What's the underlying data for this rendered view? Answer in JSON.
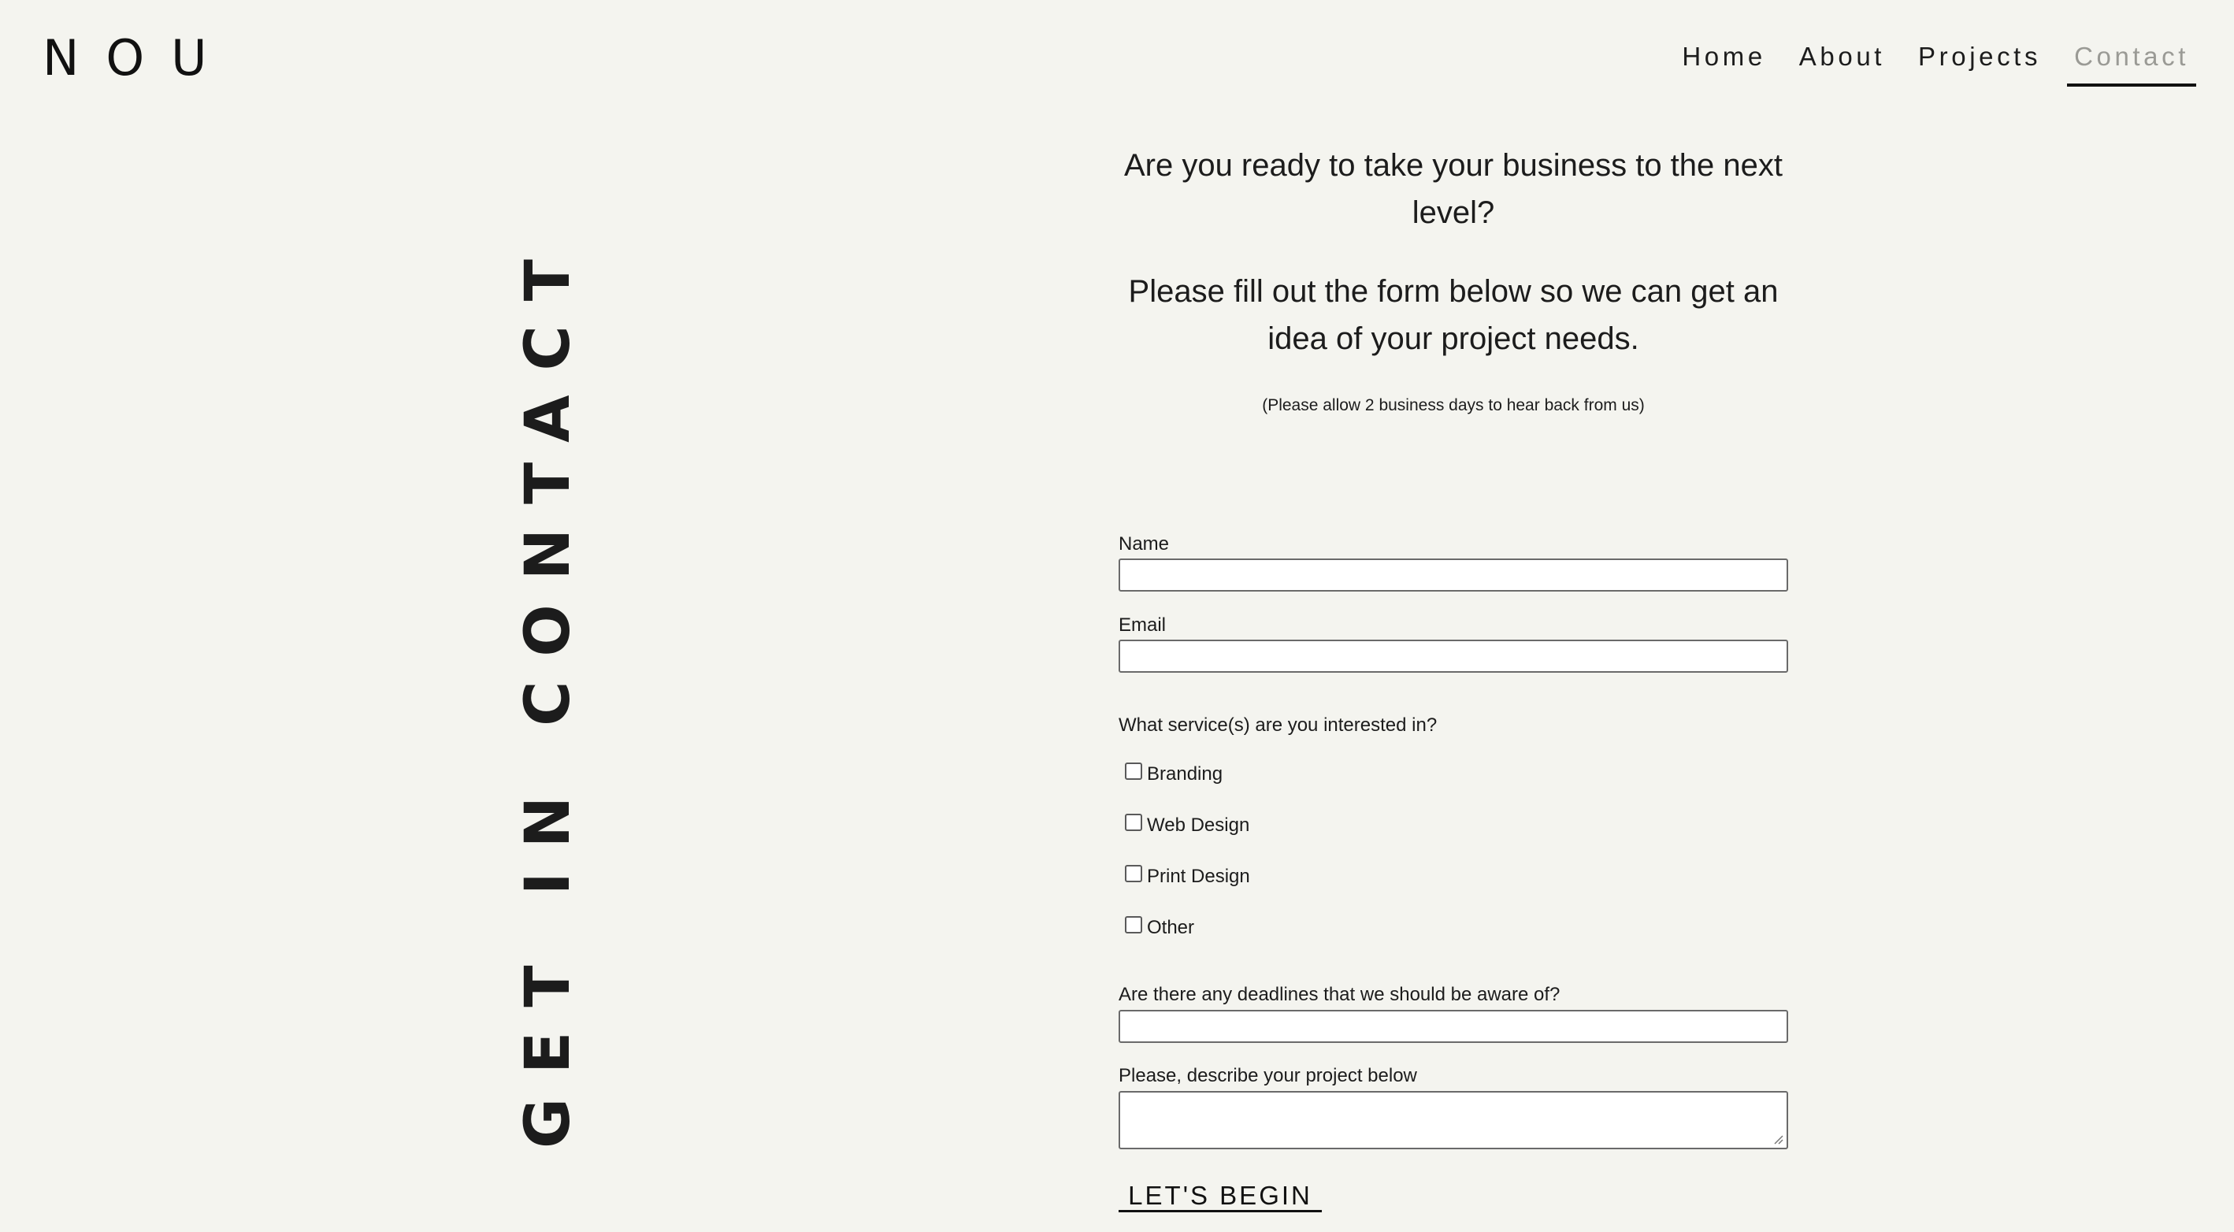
{
  "header": {
    "logo": "NOU",
    "nav": [
      {
        "label": "Home",
        "active": false
      },
      {
        "label": "About",
        "active": false
      },
      {
        "label": "Projects",
        "active": false
      },
      {
        "label": "Contact",
        "active": true
      }
    ]
  },
  "side_heading": "GET IN CONTACT",
  "intro": {
    "line1": "Are you ready to take your business to the next level?",
    "line2": "Please fill out the form below so we can get an idea of your project needs.",
    "note": "(Please allow 2 business days to hear back from us)"
  },
  "form": {
    "name_label": "Name",
    "name_value": "",
    "email_label": "Email",
    "email_value": "",
    "services_label": "What service(s) are you interested in?",
    "services": [
      {
        "label": "Branding",
        "checked": false
      },
      {
        "label": "Web Design",
        "checked": false
      },
      {
        "label": "Print Design",
        "checked": false
      },
      {
        "label": "Other",
        "checked": false
      }
    ],
    "deadlines_label": "Are there any deadlines that we should be aware of?",
    "deadlines_value": "",
    "description_label": "Please, describe your project below",
    "description_value": "",
    "submit_label": " LET'S BEGIN "
  },
  "colors": {
    "background": "#f4f4ef",
    "text": "#1c1c1c",
    "nav_active": "#9a9a95",
    "input_border": "#6a6a6a"
  }
}
